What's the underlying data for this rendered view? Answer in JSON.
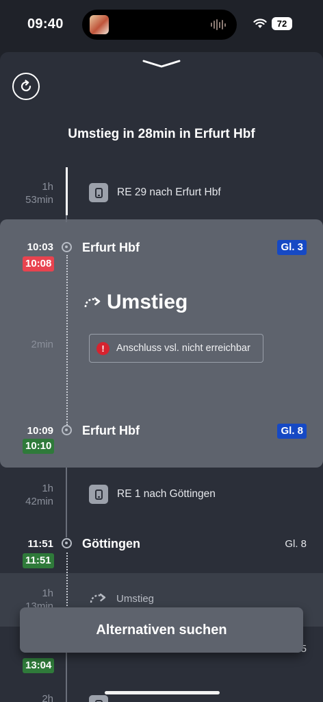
{
  "status": {
    "time": "09:40",
    "battery": "72"
  },
  "journey": {
    "title": "Umstieg in 28min in Erfurt Hbf",
    "leg1": {
      "duration_h": "1h",
      "duration_min": "53min",
      "train": "RE 29 nach Erfurt Hbf"
    },
    "transfer": {
      "arrival": {
        "scheduled": "10:03",
        "realtime": "10:08",
        "station": "Erfurt Hbf",
        "platform": "Gl. 3"
      },
      "label": "Umstieg",
      "duration": "2min",
      "warning": "Anschluss vsl. nicht erreichbar",
      "departure": {
        "scheduled": "10:09",
        "realtime": "10:10",
        "station": "Erfurt Hbf",
        "platform": "Gl. 8"
      }
    },
    "leg2": {
      "duration_h": "1h",
      "duration_min": "42min",
      "train": "RE 1 nach Göttingen"
    },
    "stop_goettingen": {
      "scheduled": "11:51",
      "realtime": "11:51",
      "station": "Göttingen",
      "platform": "Gl. 8"
    },
    "transfer2": {
      "duration_h": "1h",
      "duration_min": "13min",
      "label": "Umstieg"
    },
    "next_stop": {
      "realtime": "13:04",
      "platform_suffix": "5"
    },
    "leg3": {
      "duration_h": "2h"
    }
  },
  "actions": {
    "alternatives_label": "Alternativen suchen"
  }
}
